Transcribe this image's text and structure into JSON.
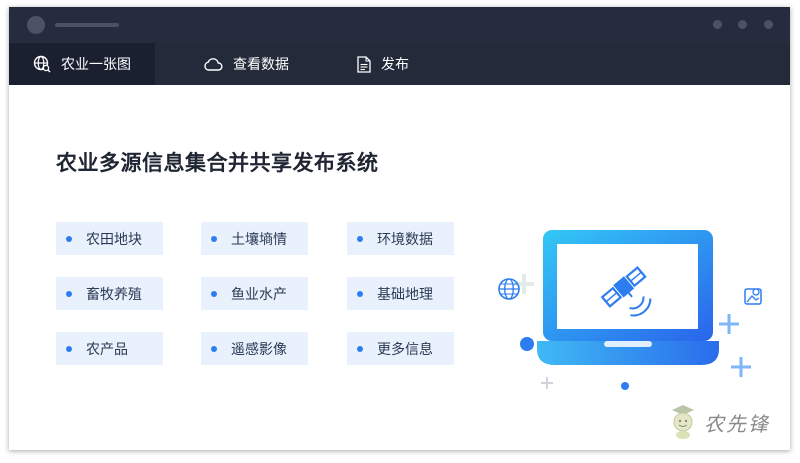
{
  "nav": {
    "tabs": [
      {
        "label": "农业一张图",
        "icon": "globe-search-icon",
        "active": true
      },
      {
        "label": "查看数据",
        "icon": "cloud-icon",
        "active": false
      },
      {
        "label": "发布",
        "icon": "document-icon",
        "active": false
      }
    ]
  },
  "main": {
    "title": "农业多源信息集合并共享发布系统",
    "categories": [
      {
        "label": "农田地块"
      },
      {
        "label": "土壤墒情"
      },
      {
        "label": "环境数据"
      },
      {
        "label": "畜牧养殖"
      },
      {
        "label": "鱼业水产"
      },
      {
        "label": "基础地理"
      },
      {
        "label": "农产品"
      },
      {
        "label": "遥感影像"
      },
      {
        "label": "更多信息"
      }
    ]
  },
  "watermark": {
    "text": "农先锋"
  },
  "colors": {
    "titlebar": "#252c3d",
    "navbar": "#232a3a",
    "accent": "#2d7df0",
    "chip_bg": "#e8f1fc"
  }
}
